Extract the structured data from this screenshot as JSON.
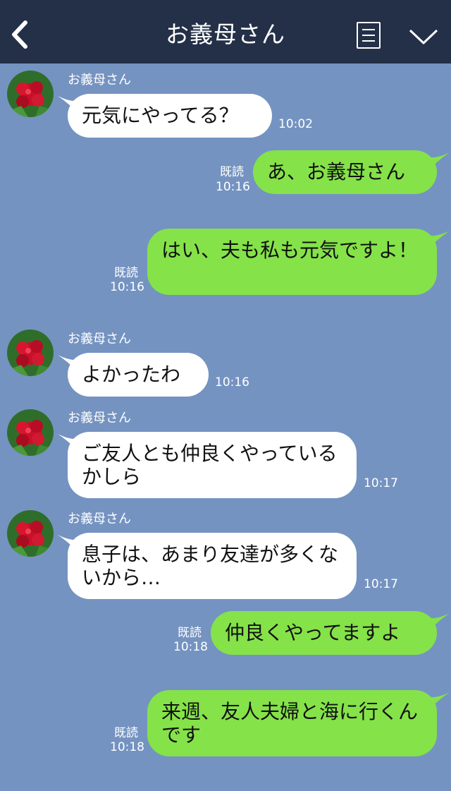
{
  "header": {
    "title": "お義母さん",
    "back_icon": "chevron-left-icon",
    "menu_icon": "menu-icon",
    "dropdown_icon": "chevron-down-icon"
  },
  "colors": {
    "header_bg": "#243047",
    "chat_bg": "#7493c1",
    "incoming_bubble": "#ffffff",
    "outgoing_bubble": "#85e249"
  },
  "messages": [
    {
      "direction": "in",
      "sender": "お義母さん",
      "text": "元気にやってる？",
      "time": "10:02"
    },
    {
      "direction": "out",
      "text": "あ、お義母さん",
      "read": "既読",
      "time": "10:16"
    },
    {
      "direction": "out",
      "text": "はい、夫も私も元気ですよ！",
      "read": "既読",
      "time": "10:16"
    },
    {
      "direction": "in",
      "sender": "お義母さん",
      "text": "よかったわ",
      "time": "10:16"
    },
    {
      "direction": "in",
      "sender": "お義母さん",
      "text": "ご友人とも仲良くやっているかしら",
      "time": "10:17"
    },
    {
      "direction": "in",
      "sender": "お義母さん",
      "text": "息子は、あまり友達が多くないから…",
      "time": "10:17"
    },
    {
      "direction": "out",
      "text": "仲良くやってますよ",
      "read": "既読",
      "time": "10:18"
    },
    {
      "direction": "out",
      "text": "来週、友人夫婦と海に行くんです",
      "read": "既読",
      "time": "10:18"
    }
  ]
}
